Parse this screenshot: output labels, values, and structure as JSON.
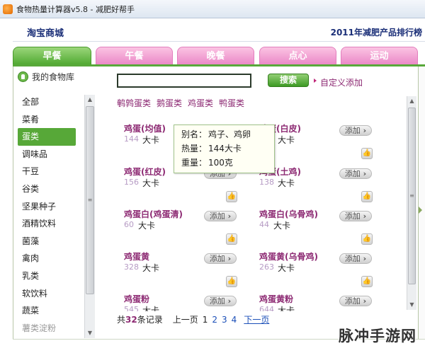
{
  "window": {
    "title": "食物热量计算器v5.8 - 减肥好帮手"
  },
  "header": {
    "brand": "淘宝商城",
    "ranking": "2011年减肥产品排行榜"
  },
  "tabs": [
    {
      "label": "早餐",
      "active": true
    },
    {
      "label": "午餐",
      "active": false
    },
    {
      "label": "晚餐",
      "active": false
    },
    {
      "label": "点心",
      "active": false
    },
    {
      "label": "运动",
      "active": false
    }
  ],
  "library": {
    "title": "我的食物库",
    "icon": "food-library-icon",
    "categories": [
      "全部",
      "菜肴",
      "蛋类",
      "调味品",
      "干豆",
      "谷类",
      "坚果种子",
      "酒精饮料",
      "菌藻",
      "禽肉",
      "乳类",
      "软饮料",
      "蔬菜",
      "薯类淀粉"
    ],
    "active_category": "蛋类"
  },
  "search": {
    "value": "",
    "button_label": "搜索",
    "custom_link": "自定义添加"
  },
  "subcategories": [
    "鹌鹑蛋类",
    "鹅蛋类",
    "鸡蛋类",
    "鸭蛋类"
  ],
  "foods": [
    {
      "name": "鸡蛋(均值)",
      "calories": "144",
      "unit": "大卡",
      "add_label": "添加"
    },
    {
      "name": "鸡蛋(白皮)",
      "calories": "138",
      "unit": "大卡",
      "add_label": "添加"
    },
    {
      "name": "鸡蛋(红皮)",
      "calories": "156",
      "unit": "大卡",
      "add_label": "添加"
    },
    {
      "name": "鸡蛋(土鸡)",
      "calories": "138",
      "unit": "大卡",
      "add_label": "添加"
    },
    {
      "name": "鸡蛋白(鸡蛋清)",
      "calories": "60",
      "unit": "大卡",
      "add_label": "添加"
    },
    {
      "name": "鸡蛋白(乌骨鸡)",
      "calories": "44",
      "unit": "大卡",
      "add_label": "添加"
    },
    {
      "name": "鸡蛋黄",
      "calories": "328",
      "unit": "大卡",
      "add_label": "添加"
    },
    {
      "name": "鸡蛋黄(乌骨鸡)",
      "calories": "263",
      "unit": "大卡",
      "add_label": "添加"
    },
    {
      "name": "鸡蛋粉",
      "calories": "545",
      "unit": "大卡",
      "add_label": "添加"
    },
    {
      "name": "鸡蛋黄粉",
      "calories": "644",
      "unit": "大卡",
      "add_label": "添加"
    }
  ],
  "tooltip": {
    "alias_label": "别名：",
    "alias": "鸡子、鸡卵",
    "calories_label": "热量：",
    "calories": "144大卡",
    "weight_label": "重量：",
    "weight": "100克"
  },
  "pager": {
    "prefix": "共",
    "count": "32",
    "suffix": "条记录",
    "prev": "上一页",
    "pages": [
      "1",
      "2",
      "3",
      "4"
    ],
    "current_page": "1",
    "next": "下一页"
  },
  "watermark": "脉冲手游网"
}
